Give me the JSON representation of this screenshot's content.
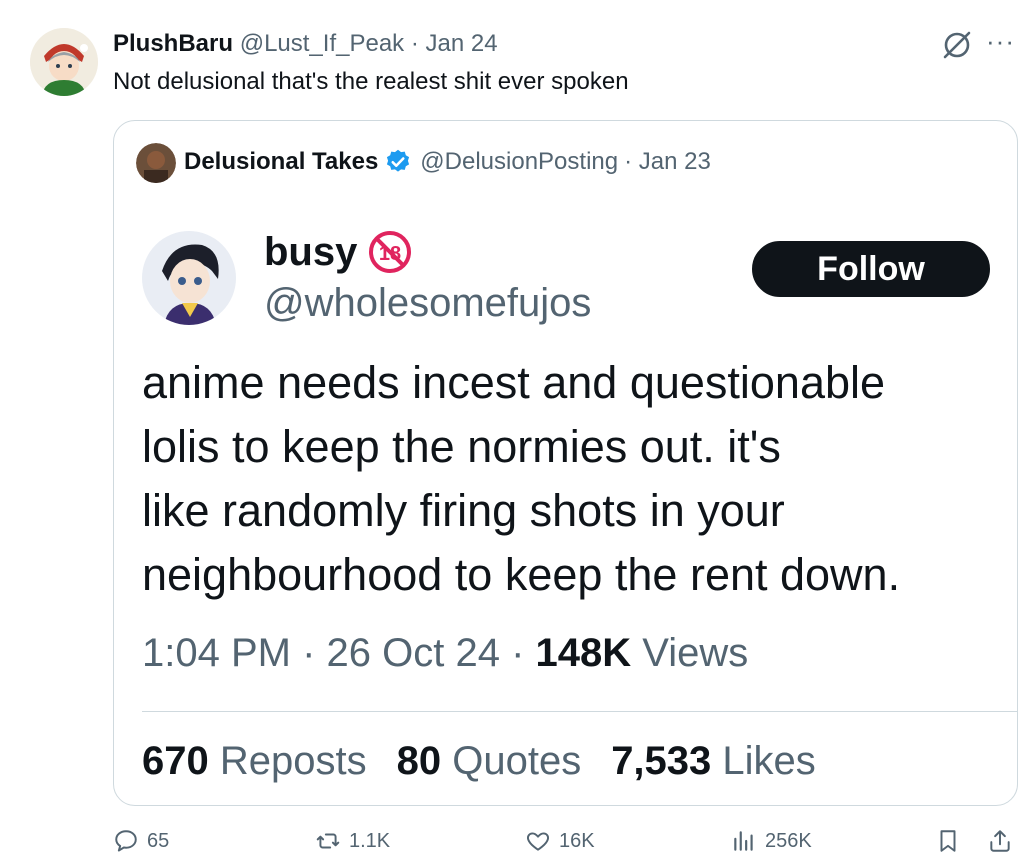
{
  "post": {
    "display_name": "PlushBaru",
    "handle": "@Lust_If_Peak",
    "date": "· Jan 24",
    "text": "Not delusional that's the realest shit ever spoken"
  },
  "quoted": {
    "display_name": "Delusional Takes",
    "handle": "@DelusionPosting",
    "date": "· Jan 23",
    "embedded": {
      "name": "busy",
      "badge": "18",
      "handle": "@wholesomefujos",
      "follow_label": "Follow",
      "lines": [
        "anime needs incest and questionable",
        "lolis to keep the normies out. it's",
        "like randomly firing shots in your",
        "neighbourhood to keep the rent down."
      ],
      "time": "1:04 PM · 26 Oct 24 · ",
      "views_count": "148K",
      "views_label": " Views",
      "reposts_count": "670",
      "reposts_label": " Reposts",
      "quotes_count": "80",
      "quotes_label": " Quotes",
      "likes_count": "7,533",
      "likes_label": " Likes"
    }
  },
  "actions": {
    "replies": "65",
    "reposts": "1.1K",
    "likes": "16K",
    "views": "256K"
  },
  "colors": {
    "text": "#0f1419",
    "muted": "#536471",
    "border": "#cfd9de",
    "verified": "#1d9bf0",
    "badge": "#e0245e"
  }
}
